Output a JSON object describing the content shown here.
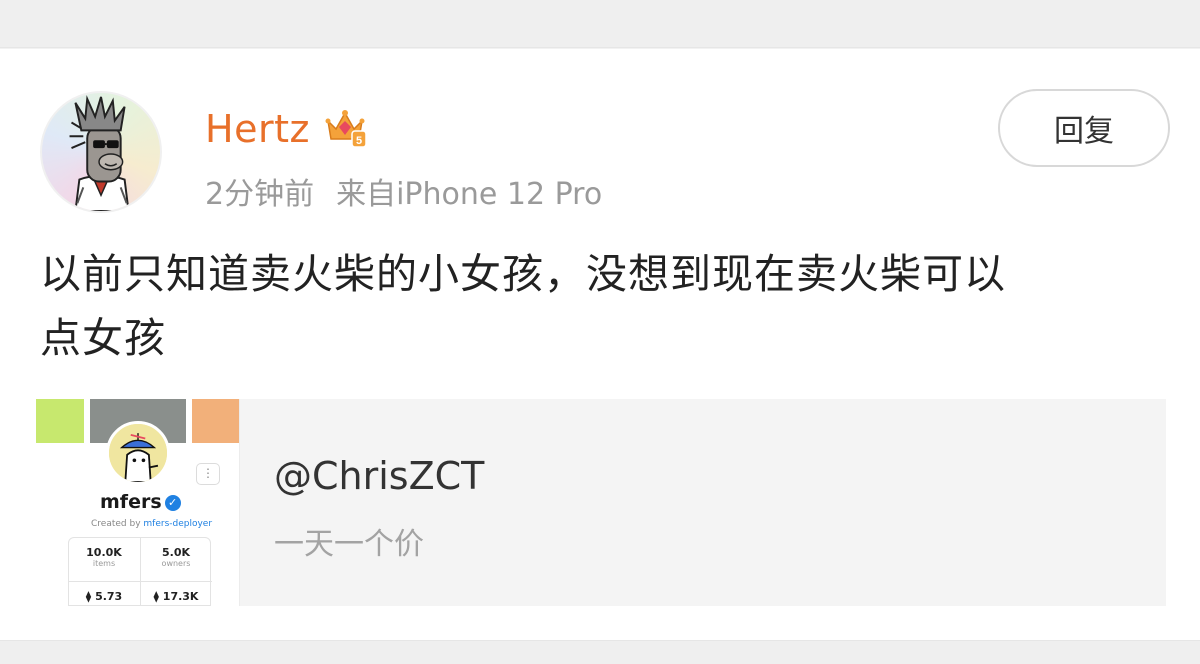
{
  "post": {
    "username": "Hertz",
    "badge_icon": "crown-vip-icon",
    "time": "2分钟前",
    "source": "来自iPhone 12 Pro",
    "reply_label": "回复",
    "text_line1": "以前只知道卖火柴的小女孩，没想到现在卖火柴可以",
    "text_line2": "点女孩",
    "accent_color": "#e8702a"
  },
  "link_card": {
    "title": "@ChrisZCT",
    "subtitle": "一天一个价",
    "thumbnail": {
      "collection_name": "mfers",
      "verified_icon": "verified-check-icon",
      "created_prefix": "Created by",
      "creator": "mfers-deployer",
      "more_label": "⋮",
      "stats": [
        {
          "value": "10.0K",
          "label": "items"
        },
        {
          "value": "5.0K",
          "label": "owners"
        },
        {
          "value": "5.73",
          "label": ""
        },
        {
          "value": "17.3K",
          "label": ""
        }
      ]
    }
  }
}
